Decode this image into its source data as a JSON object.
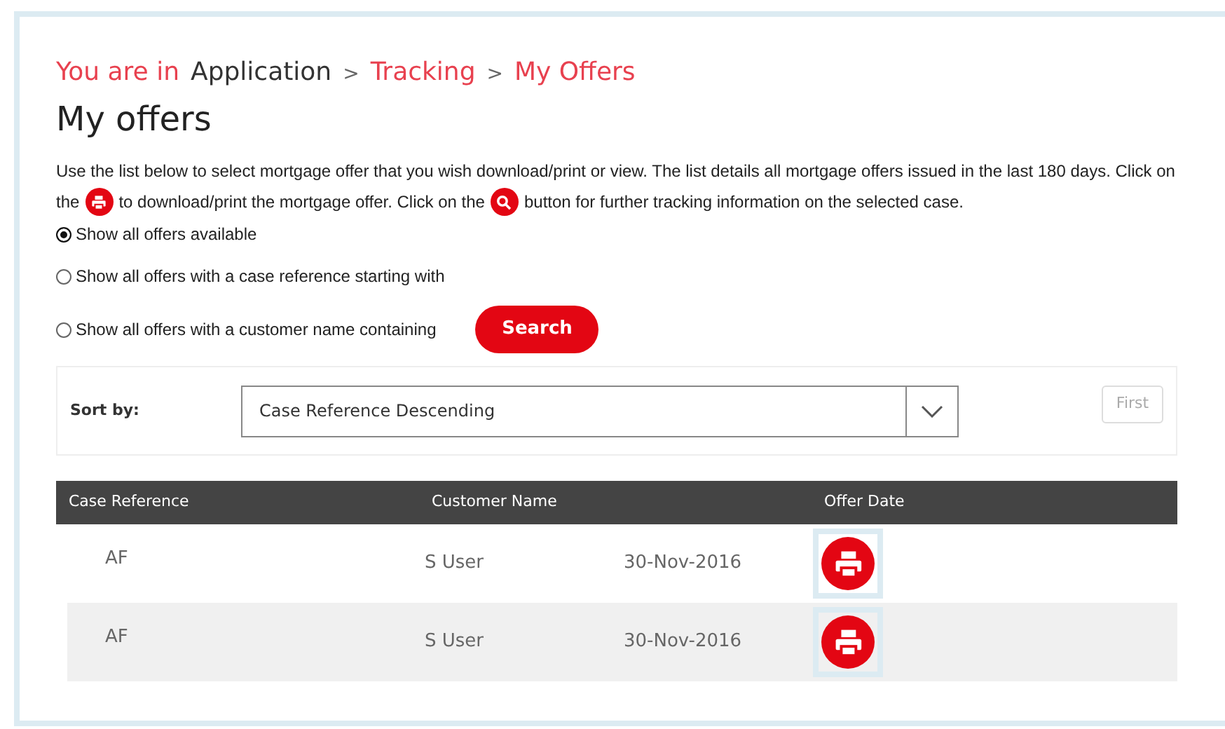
{
  "breadcrumb": {
    "prefix": "You are in",
    "items": [
      {
        "label": "Application",
        "kind": "plain",
        "separator": ">"
      },
      {
        "label": "Tracking",
        "kind": "link",
        "separator": ">"
      },
      {
        "label": "My Offers",
        "kind": "link"
      }
    ]
  },
  "title": "My offers",
  "intro": [
    "Use the list below to select mortgage offer that you wish download/print or view. The list details all mortgage offers issued in the last 180 days. Click on",
    "the",
    "to download/print the mortgage offer. Click on the",
    "button for further tracking information on the selected case."
  ],
  "filters": [
    {
      "label": "Show all offers available",
      "selected": true
    },
    {
      "label": "Show all offers with a case reference starting with",
      "selected": false
    },
    {
      "label": "Show all offers with a customer name containing",
      "selected": false
    }
  ],
  "search_button": "Search",
  "sort": {
    "label": "Sort by:",
    "value": "Case Reference Descending"
  },
  "first_button": {
    "label": "First",
    "disabled": true
  },
  "table": {
    "columns": [
      "Case Reference",
      "Customer Name",
      "Offer Date"
    ],
    "rows": [
      {
        "case_reference": "AF",
        "customer_name": "S User",
        "offer_date": "30-Nov-2016"
      },
      {
        "case_reference": "AF",
        "customer_name": "S User",
        "offer_date": "30-Nov-2016"
      }
    ]
  }
}
